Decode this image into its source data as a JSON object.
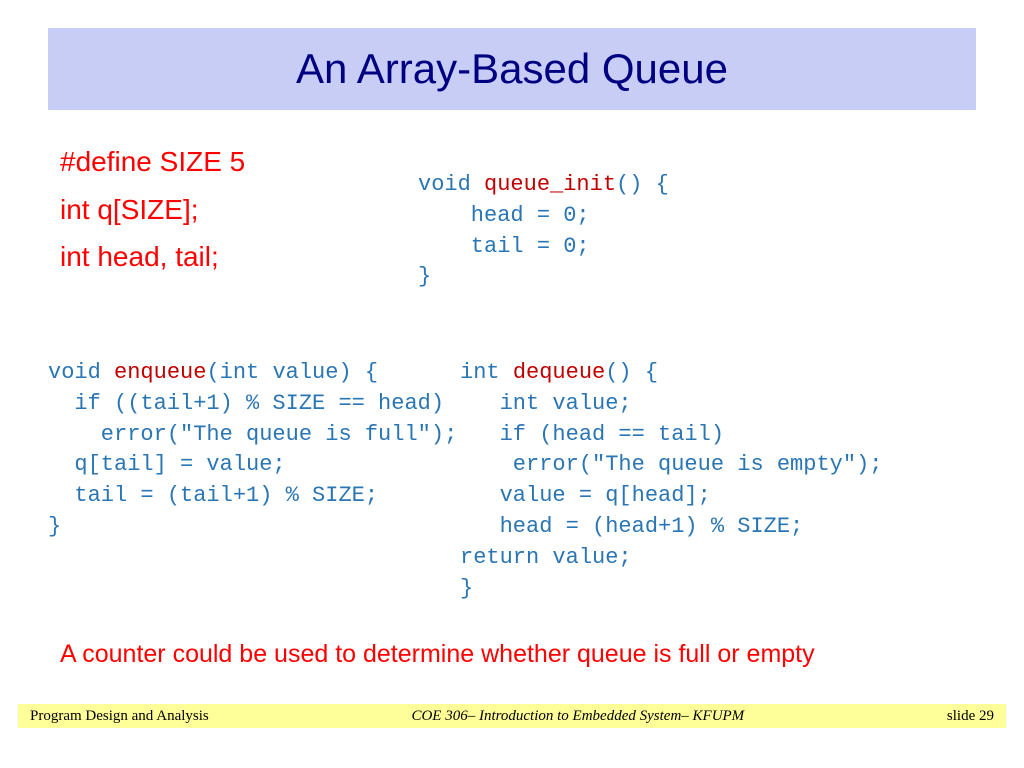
{
  "title": "An Array-Based Queue",
  "declarations": {
    "line1": "#define SIZE 5",
    "line2": "int q[SIZE];",
    "line3": "int head, tail;"
  },
  "code": {
    "init": {
      "kw1": "void ",
      "fn": "queue_init",
      "rest": "() {\n    head = 0;\n    tail = 0;\n}"
    },
    "enqueue": {
      "kw1": "void ",
      "fn": "enqueue",
      "rest": "(int value) {\n  if ((tail+1) % SIZE == head)\n    error(\"The queue is full\");\n  q[tail] = value;\n  tail = (tail+1) % SIZE;\n}"
    },
    "dequeue": {
      "kw1": "int ",
      "fn": "dequeue",
      "rest": "() {\n   int value;\n   if (head == tail)\n    error(\"The queue is empty\");\n   value = q[head];\n   head = (head+1) % SIZE;\nreturn value;\n}"
    }
  },
  "note": "A counter could be used to determine whether queue is full or empty",
  "footer": {
    "left": "Program Design and Analysis",
    "center": "COE 306– Introduction to Embedded System– KFUPM",
    "right": "slide 29"
  }
}
